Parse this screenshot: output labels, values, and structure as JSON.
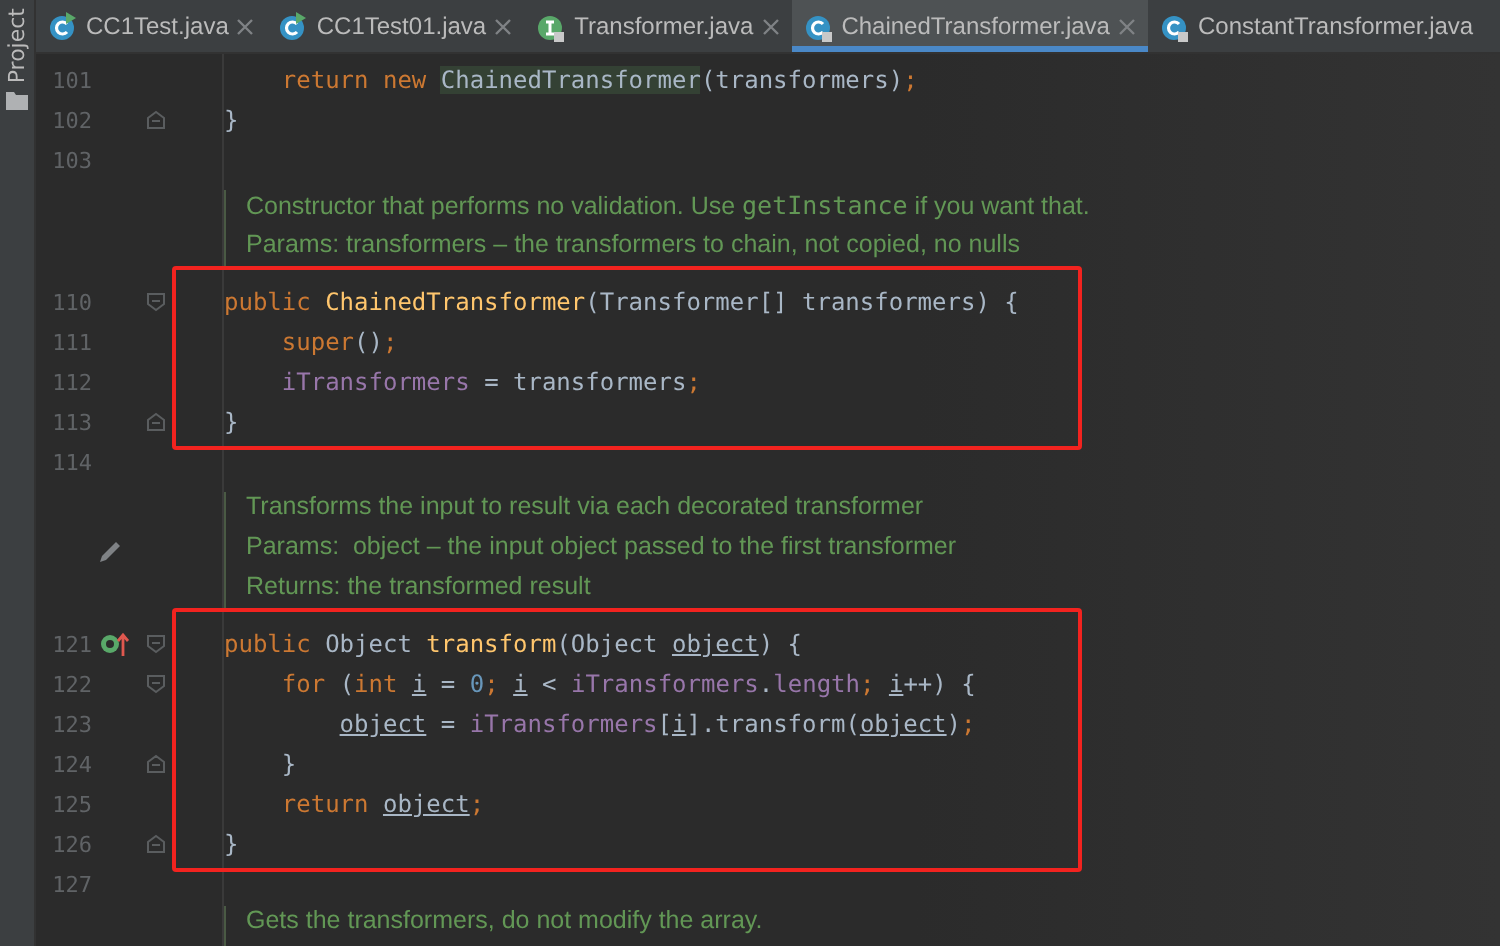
{
  "side_strip": {
    "label": "Project"
  },
  "tabs": [
    {
      "label": "CC1Test.java",
      "kind": "runnable",
      "selected": false,
      "closable": true
    },
    {
      "label": "CC1Test01.java",
      "kind": "runnable",
      "selected": false,
      "closable": true
    },
    {
      "label": "Transformer.java",
      "kind": "interface",
      "selected": false,
      "closable": true
    },
    {
      "label": "ChainedTransformer.java",
      "kind": "library",
      "selected": true,
      "closable": true
    },
    {
      "label": "ConstantTransformer.java",
      "kind": "library",
      "selected": false,
      "closable": false
    }
  ],
  "editor": {
    "lines": [
      {
        "kind": "code",
        "number": "101",
        "tokens": [
          {
            "text": "    return ",
            "kind": "keyword"
          },
          {
            "text": "new ",
            "kind": "keyword"
          },
          {
            "text": "ChainedTransformer",
            "kind": "usage"
          },
          {
            "text": "(transformers)",
            "kind": "plain"
          },
          {
            "text": ";",
            "kind": "keyword"
          }
        ]
      },
      {
        "kind": "code",
        "number": "102",
        "fold_end": true,
        "tokens": [
          {
            "text": "}",
            "kind": "plain"
          }
        ]
      },
      {
        "kind": "code",
        "number": "103"
      },
      {
        "kind": "doc",
        "lines": [
          [
            {
              "text": "Constructor that performs no validation. Use ",
              "kind": "text"
            },
            {
              "text": "getInstance",
              "kind": "code"
            },
            {
              "text": " if you want that.",
              "kind": "text"
            }
          ],
          [
            {
              "text": "Params: transformers – the transformers to chain, not copied, no nulls",
              "kind": "text"
            }
          ]
        ]
      },
      {
        "kind": "highlight",
        "lines": [
          {
            "kind": "code",
            "number": "110",
            "fold_start": true,
            "tokens": [
              {
                "text": "public ",
                "kind": "keyword"
              },
              {
                "text": "ChainedTransformer",
                "kind": "function"
              },
              {
                "text": "(Transformer[] transformers) {",
                "kind": "plain"
              }
            ]
          },
          {
            "kind": "code",
            "number": "111",
            "tokens": [
              {
                "text": "    super",
                "kind": "keyword"
              },
              {
                "text": "()",
                "kind": "plain"
              },
              {
                "text": ";",
                "kind": "keyword"
              }
            ]
          },
          {
            "kind": "code",
            "number": "112",
            "tokens": [
              {
                "text": "    iTransformers",
                "kind": "field"
              },
              {
                "text": " = transformers",
                "kind": "plain"
              },
              {
                "text": ";",
                "kind": "keyword"
              }
            ]
          },
          {
            "kind": "code",
            "number": "113",
            "fold_end": true,
            "tokens": [
              {
                "text": "}",
                "kind": "plain"
              }
            ]
          }
        ]
      },
      {
        "kind": "code",
        "number": "114"
      },
      {
        "kind": "doc",
        "editable": true,
        "lines": [
          [
            {
              "text": "Transforms the input to result via each decorated transformer",
              "kind": "text"
            }
          ],
          [
            {
              "text": "Params:  object – the input object passed to the first transformer",
              "kind": "text"
            }
          ],
          [
            {
              "text": "Returns: the transformed result",
              "kind": "text"
            }
          ]
        ]
      },
      {
        "kind": "highlight",
        "lines": [
          {
            "kind": "code",
            "number": "121",
            "fold_start": true,
            "overrides": true,
            "tokens": [
              {
                "text": "public ",
                "kind": "keyword"
              },
              {
                "text": "Object ",
                "kind": "plain"
              },
              {
                "text": "transform",
                "kind": "function"
              },
              {
                "text": "(Object ",
                "kind": "plain"
              },
              {
                "text": "object",
                "kind": "variable"
              },
              {
                "text": ") {",
                "kind": "plain"
              }
            ]
          },
          {
            "kind": "code",
            "number": "122",
            "fold_start": true,
            "tokens": [
              {
                "text": "    for ",
                "kind": "keyword"
              },
              {
                "text": "(",
                "kind": "plain"
              },
              {
                "text": "int ",
                "kind": "keyword"
              },
              {
                "text": "i",
                "kind": "variable"
              },
              {
                "text": " = ",
                "kind": "plain"
              },
              {
                "text": "0",
                "kind": "number"
              },
              {
                "text": "; ",
                "kind": "keyword"
              },
              {
                "text": "i",
                "kind": "variable"
              },
              {
                "text": " < ",
                "kind": "plain"
              },
              {
                "text": "iTransformers",
                "kind": "field"
              },
              {
                "text": ".",
                "kind": "plain"
              },
              {
                "text": "length",
                "kind": "field"
              },
              {
                "text": "; ",
                "kind": "keyword"
              },
              {
                "text": "i",
                "kind": "variable"
              },
              {
                "text": "++) {",
                "kind": "plain"
              }
            ]
          },
          {
            "kind": "code",
            "number": "123",
            "tokens": [
              {
                "text": "        object",
                "kind": "variable"
              },
              {
                "text": " = ",
                "kind": "plain"
              },
              {
                "text": "iTransformers",
                "kind": "field"
              },
              {
                "text": "[",
                "kind": "plain"
              },
              {
                "text": "i",
                "kind": "variable"
              },
              {
                "text": "].transform(",
                "kind": "plain"
              },
              {
                "text": "object",
                "kind": "variable"
              },
              {
                "text": ")",
                "kind": "plain"
              },
              {
                "text": ";",
                "kind": "keyword"
              }
            ]
          },
          {
            "kind": "code",
            "number": "124",
            "fold_end": true,
            "tokens": [
              {
                "text": "    }",
                "kind": "plain"
              }
            ]
          },
          {
            "kind": "code",
            "number": "125",
            "tokens": [
              {
                "text": "    return ",
                "kind": "keyword"
              },
              {
                "text": "object",
                "kind": "variable"
              },
              {
                "text": ";",
                "kind": "keyword"
              }
            ]
          },
          {
            "kind": "code",
            "number": "126",
            "fold_end": true,
            "tokens": [
              {
                "text": "}",
                "kind": "plain"
              }
            ]
          }
        ]
      },
      {
        "kind": "code",
        "number": "127"
      },
      {
        "kind": "doc",
        "lines": [
          [
            {
              "text": "Gets the transformers, do not modify the array.",
              "kind": "text"
            }
          ]
        ]
      }
    ]
  }
}
